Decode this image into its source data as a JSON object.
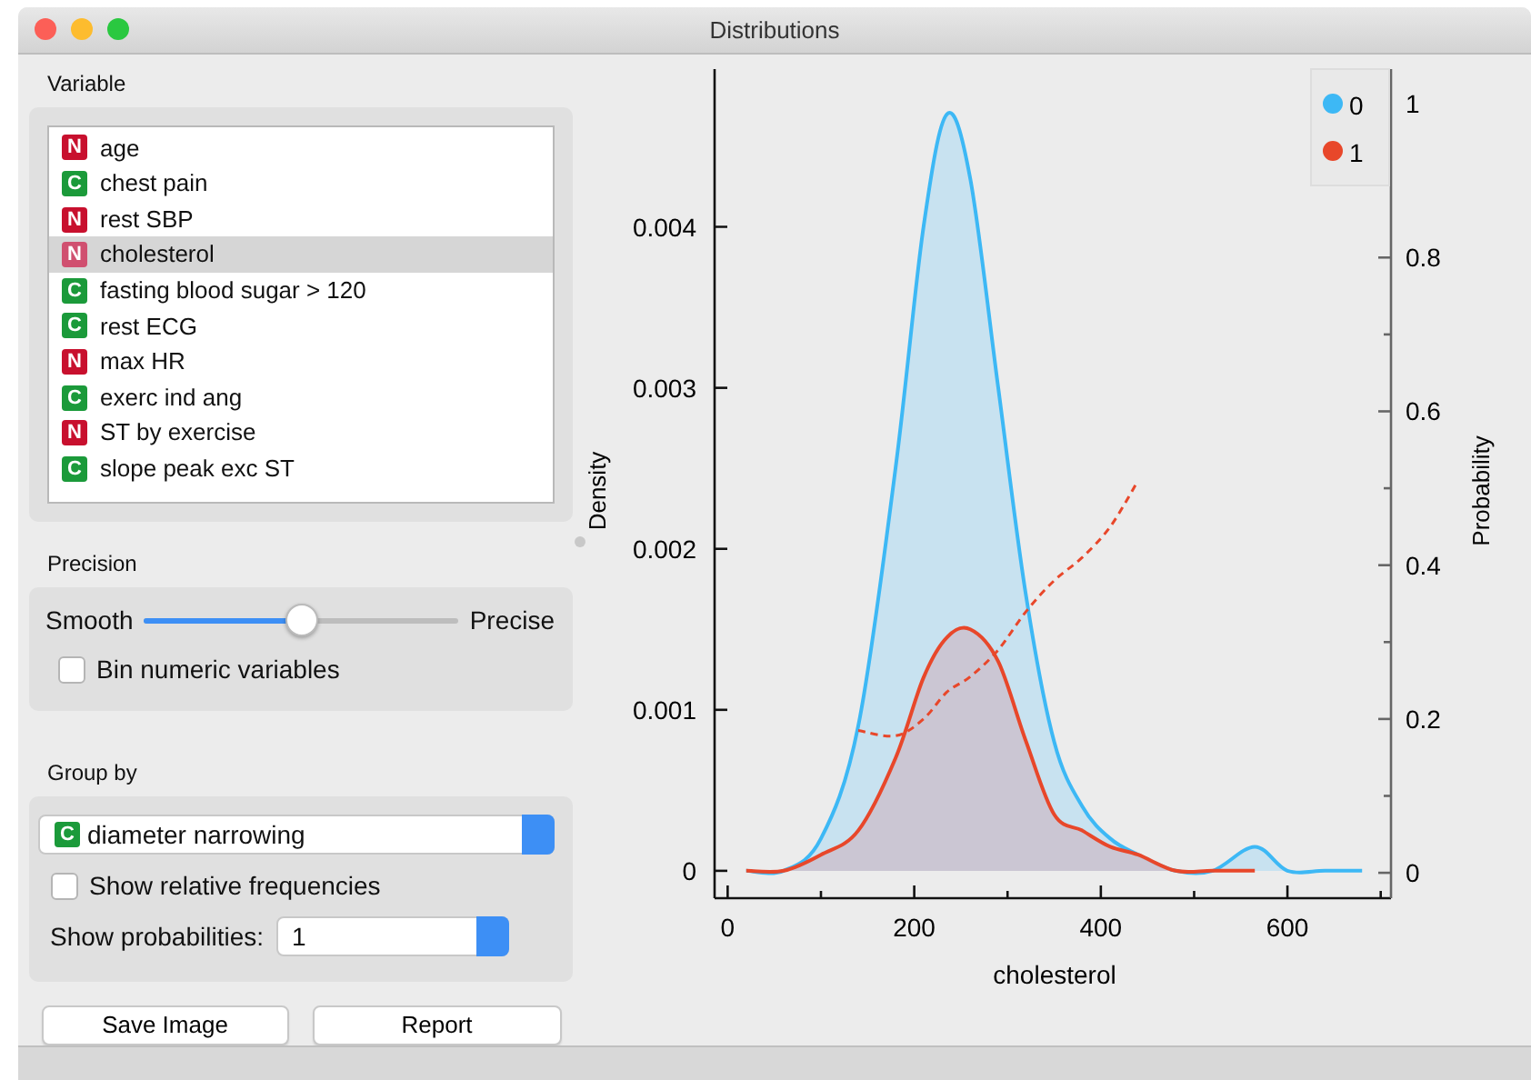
{
  "window": {
    "title": "Distributions"
  },
  "variable": {
    "label": "Variable",
    "items": [
      {
        "type": "N",
        "name": "age",
        "selected": false
      },
      {
        "type": "C",
        "name": "chest pain",
        "selected": false
      },
      {
        "type": "N",
        "name": "rest SBP",
        "selected": false
      },
      {
        "type": "N",
        "name": "cholesterol",
        "selected": true
      },
      {
        "type": "C",
        "name": "fasting blood sugar > 120",
        "selected": false
      },
      {
        "type": "C",
        "name": "rest ECG",
        "selected": false
      },
      {
        "type": "N",
        "name": "max HR",
        "selected": false
      },
      {
        "type": "C",
        "name": "exerc ind ang",
        "selected": false
      },
      {
        "type": "N",
        "name": "ST by exercise",
        "selected": false
      },
      {
        "type": "C",
        "name": "slope peak exc ST",
        "selected": false
      }
    ]
  },
  "precision": {
    "label": "Precision",
    "left_label": "Smooth",
    "right_label": "Precise",
    "level": 0.5,
    "bin_checkbox": {
      "label": "Bin numeric variables",
      "checked": false
    }
  },
  "group_by": {
    "label": "Group by",
    "select": {
      "type": "C",
      "value": "diameter narrowing"
    },
    "relative_checkbox": {
      "label": "Show relative frequencies",
      "checked": false
    },
    "probabilities": {
      "label": "Show probabilities:",
      "value": "1"
    }
  },
  "buttons": [
    "Save Image",
    "Report"
  ],
  "chart": {
    "chart_data": {
      "type": "area",
      "xlabel": "cholesterol",
      "ylabel": "Density",
      "y2label": "Probability",
      "x": [
        20,
        60,
        100,
        140,
        180,
        210,
        235,
        260,
        290,
        320,
        350,
        380,
        410,
        440,
        480,
        520,
        565,
        600,
        640,
        680
      ],
      "series": [
        {
          "name": "0",
          "color": "#3db8f5",
          "values": [
            0,
            0,
            0.0002,
            0.0009,
            0.0025,
            0.004,
            0.0047,
            0.0043,
            0.003,
            0.0017,
            0.0008,
            0.0004,
            0.0002,
            0.0001,
            0,
            0,
            0.00015,
            0,
            0,
            0
          ]
        },
        {
          "name": "1",
          "color": "#e8472a",
          "values": [
            0,
            0,
            0.0001,
            0.00025,
            0.0007,
            0.0012,
            0.00145,
            0.0015,
            0.0013,
            0.0008,
            0.00035,
            0.00025,
            0.00015,
            0.0001,
            0,
            0,
            0,
            null,
            null,
            null
          ]
        },
        {
          "type": "line",
          "line_style": "dashed",
          "color": "#e8472a",
          "axis": "y2",
          "values": [
            null,
            null,
            null,
            0.185,
            0.178,
            0.2,
            0.235,
            0.255,
            0.29,
            0.34,
            0.38,
            0.41,
            0.45,
            0.51,
            null,
            null,
            null,
            null,
            null,
            null
          ]
        }
      ],
      "legend": "top-right",
      "xlim": [
        -14,
        711
      ],
      "ylim": [
        -0.00017,
        0.00498
      ],
      "y2lim": [
        -0.033,
        1.045
      ],
      "xticks": [
        0,
        200,
        400,
        600
      ],
      "yticks": [
        0,
        0.001,
        0.002,
        0.003,
        0.004
      ],
      "y2ticks": [
        0,
        0.2,
        0.4,
        0.6,
        0.8,
        1
      ]
    }
  }
}
